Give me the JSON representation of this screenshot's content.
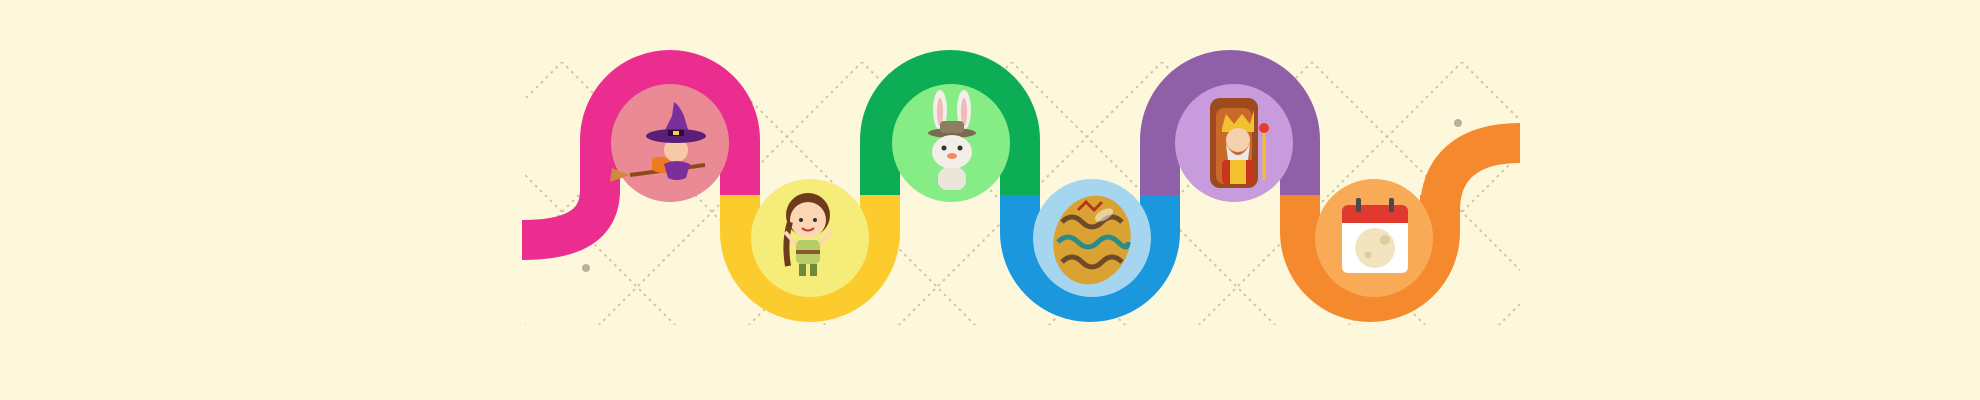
{
  "background": "#fdf8dc",
  "grid_color": "#cfc6a2",
  "road_segments": [
    {
      "name": "start-tail-segment",
      "color": "#ea2d8f"
    },
    {
      "name": "magenta-arch",
      "color": "#ea2d8f"
    },
    {
      "name": "yellow-valley",
      "color": "#fccb2e"
    },
    {
      "name": "green-arch",
      "color": "#0cad55"
    },
    {
      "name": "blue-valley",
      "color": "#1a97dd"
    },
    {
      "name": "purple-arch",
      "color": "#8f5fa8"
    },
    {
      "name": "orange-valley",
      "color": "#f5892e"
    },
    {
      "name": "end-tail-segment",
      "color": "#f5892e"
    }
  ],
  "nodes": [
    {
      "name": "witch-node",
      "icon": "witch-on-broomstick-icon",
      "circle_color": "#ea8a95"
    },
    {
      "name": "girl-node",
      "icon": "braided-girl-icon",
      "circle_color": "#f6ec7a"
    },
    {
      "name": "bunny-node",
      "icon": "easter-bunny-hat-icon",
      "circle_color": "#86ec86"
    },
    {
      "name": "egg-node",
      "icon": "decorated-easter-egg-icon",
      "circle_color": "#a6d5ef"
    },
    {
      "name": "king-node",
      "icon": "king-on-throne-icon",
      "circle_color": "#c89bdd"
    },
    {
      "name": "calendar-node",
      "icon": "calendar-full-moon-icon",
      "circle_color": "#f9aa56"
    }
  ]
}
